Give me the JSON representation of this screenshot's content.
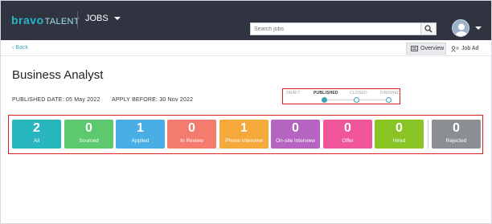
{
  "app": {
    "logo_main": "bravo",
    "logo_sub": "TALENT"
  },
  "nav": {
    "jobs_label": "JOBS"
  },
  "search": {
    "placeholder": "Search jobs"
  },
  "subnav": {
    "back_label": "‹ Back",
    "overview_label": "Overview",
    "job_ad_label": "Job Ad"
  },
  "job": {
    "title": "Business Analyst",
    "published_date_text": "PUBLISHED DATE: 05 May 2022",
    "apply_before_text": "APPLY BEFORE: 30 Nov 2022"
  },
  "status": {
    "stages": [
      "DRAFT",
      "PUBLISHED",
      "CLOSED",
      "FINISHED"
    ],
    "current": "PUBLISHED"
  },
  "pipeline": [
    {
      "count": "2",
      "label": "All",
      "color": "#27b6bd"
    },
    {
      "count": "0",
      "label": "Sourced",
      "color": "#5cc96f"
    },
    {
      "count": "1",
      "label": "Applied",
      "color": "#4aaee6"
    },
    {
      "count": "0",
      "label": "In Review",
      "color": "#f47c6e"
    },
    {
      "count": "1",
      "label": "Phone Interview",
      "color": "#f5a93a"
    },
    {
      "count": "0",
      "label": "On-site Interview",
      "color": "#b565c1"
    },
    {
      "count": "0",
      "label": "Offer",
      "color": "#f2569a"
    },
    {
      "count": "0",
      "label": "Hired",
      "color": "#88c424"
    },
    {
      "count": "0",
      "label": "Rejected",
      "color": "#8b8f94"
    }
  ],
  "colors": {
    "topbar": "#2f3440",
    "accent": "#3aa3b8",
    "highlight_border": "#e02020"
  },
  "icons": {
    "search": "search-icon",
    "user": "user-avatar-icon",
    "overview": "overview-icon",
    "job_ad": "job-ad-icon"
  }
}
